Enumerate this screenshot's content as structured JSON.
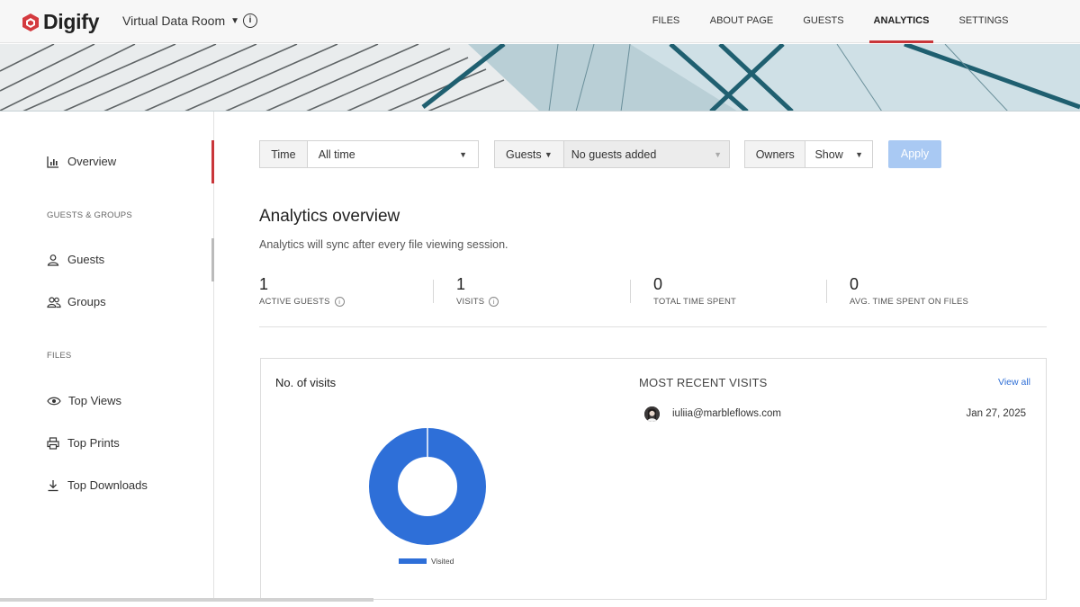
{
  "app": {
    "logo": "Digify",
    "room": "Virtual Data Room"
  },
  "nav": [
    {
      "label": "FILES"
    },
    {
      "label": "ABOUT PAGE"
    },
    {
      "label": "GUESTS"
    },
    {
      "label": "ANALYTICS",
      "active": true
    },
    {
      "label": "SETTINGS"
    }
  ],
  "sidebar": {
    "overview": "Overview",
    "guests_groups_heading": "GUESTS & GROUPS",
    "guests": "Guests",
    "groups": "Groups",
    "files_heading": "FILES",
    "top_views": "Top Views",
    "top_prints": "Top Prints",
    "top_downloads": "Top Downloads"
  },
  "filters": {
    "time_label": "Time",
    "time_value": "All time",
    "guests_label": "Guests",
    "guests_value": "No guests added",
    "owners_label": "Owners",
    "owners_value": "Show",
    "apply_label": "Apply"
  },
  "overview": {
    "title": "Analytics overview",
    "subtitle": "Analytics will sync after every file viewing session."
  },
  "stats": [
    {
      "value": "1",
      "label": "ACTIVE GUESTS",
      "info": true
    },
    {
      "value": "1",
      "label": "VISITS",
      "info": true
    },
    {
      "value": "0",
      "label": "TOTAL TIME SPENT",
      "info": false
    },
    {
      "value": "0",
      "label": "AVG. TIME SPENT ON FILES",
      "info": false
    }
  ],
  "visits_chart": {
    "title": "No. of visits",
    "legend": "Visited",
    "color": "#2e6fd8"
  },
  "chart_data": {
    "type": "pie",
    "categories": [
      "Visited"
    ],
    "values": [
      1
    ],
    "title": "No. of visits"
  },
  "recent": {
    "title": "MOST RECENT VISITS",
    "view_all": "View all",
    "rows": [
      {
        "email": "iuliia@marbleflows.com",
        "date": "Jan 27, 2025"
      }
    ]
  },
  "colors": {
    "accent": "#c9363a",
    "primary": "#2e6fd8",
    "apply_disabled": "#a9c9f3"
  }
}
